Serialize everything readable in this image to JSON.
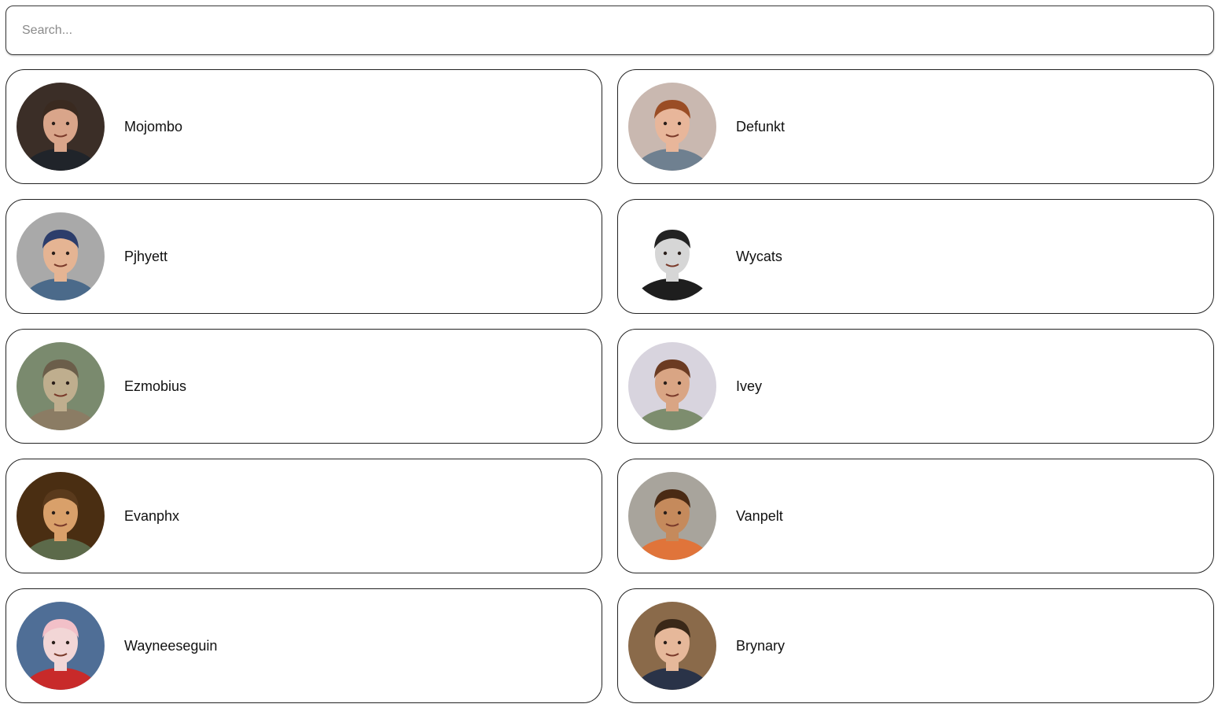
{
  "search": {
    "placeholder": "Search..."
  },
  "users": [
    {
      "name": "Mojombo",
      "avatar": "mojombo-avatar",
      "bg": "#3b2e27",
      "skin": "#d9a58a",
      "hair": "#3a2a20",
      "shirt": "#20242a"
    },
    {
      "name": "Defunkt",
      "avatar": "defunkt-avatar",
      "bg": "#c9b8b0",
      "skin": "#e8b69a",
      "hair": "#9a4d25",
      "shirt": "#6f8090"
    },
    {
      "name": "Pjhyett",
      "avatar": "pjhyett-avatar",
      "bg": "#a9a9a9",
      "skin": "#e5b493",
      "hair": "#2c3d6b",
      "shirt": "#4b6a8a"
    },
    {
      "name": "Wycats",
      "avatar": "wycats-avatar",
      "bg": "#ffffff",
      "skin": "#d6d6d6",
      "hair": "#222222",
      "shirt": "#1e1e1e"
    },
    {
      "name": "Ezmobius",
      "avatar": "ezmobius-avatar",
      "bg": "#7a8a6e",
      "skin": "#bfae8e",
      "hair": "#6b5e4a",
      "shirt": "#8b7c64"
    },
    {
      "name": "Ivey",
      "avatar": "ivey-avatar",
      "bg": "#d8d4de",
      "skin": "#d9a584",
      "hair": "#6b3b22",
      "shirt": "#7d8d6e"
    },
    {
      "name": "Evanphx",
      "avatar": "evanphx-avatar",
      "bg": "#4a2e12",
      "skin": "#d9a06a",
      "hair": "#5a3a1c",
      "shirt": "#5c6a4a"
    },
    {
      "name": "Vanpelt",
      "avatar": "vanpelt-avatar",
      "bg": "#a8a49c",
      "skin": "#c58a5c",
      "hair": "#4a2a14",
      "shirt": "#e0743a"
    },
    {
      "name": "Wayneeseguin",
      "avatar": "wayneeseguin-avatar",
      "bg": "#4f6e96",
      "skin": "#f2d6d6",
      "hair": "#f2c0c8",
      "shirt": "#c82a2a"
    },
    {
      "name": "Brynary",
      "avatar": "brynary-avatar",
      "bg": "#8a6a4a",
      "skin": "#e6b89a",
      "hair": "#3a2818",
      "shirt": "#2a3348"
    }
  ]
}
